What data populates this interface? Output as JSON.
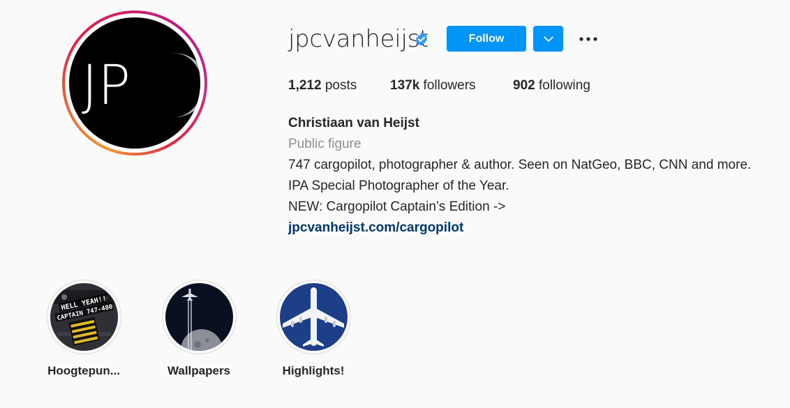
{
  "profile": {
    "username": "jpcvanheijst",
    "avatar_text": "JP",
    "verified_icon": "verified-badge-icon"
  },
  "actions": {
    "follow_label": "Follow",
    "dropdown_icon": "chevron-down-icon",
    "more_icon": "more-options-icon"
  },
  "stats": {
    "posts_count": "1,212",
    "posts_label": " posts",
    "followers_count": "137k",
    "followers_label": " followers",
    "following_count": "902",
    "following_label": " following"
  },
  "bio": {
    "full_name": "Christiaan van Heijst",
    "category": "Public figure",
    "line1": "747 cargopilot, photographer & author. Seen on NatGeo, BBC, CNN and more.",
    "line2": "IPA Special Photographer of the Year.",
    "line3": "NEW: Cargopilot Captain’s Edition ->",
    "link": "jpcvanheijst.com/cargopilot"
  },
  "highlights": [
    {
      "label": "Hoogtepun...",
      "image_text_1": "HELL YEAH!!",
      "image_text_2": "CAPTAIN 747-400"
    },
    {
      "label": "Wallpapers"
    },
    {
      "label": "Highlights!"
    }
  ],
  "colors": {
    "accent": "#0095f6",
    "link": "#00376b",
    "muted": "#8e8e8e",
    "text": "#262626"
  }
}
